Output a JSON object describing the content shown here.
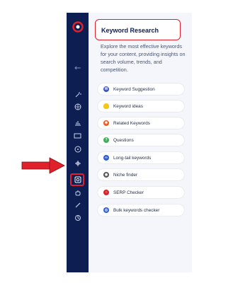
{
  "panel": {
    "title": "Keyword Research",
    "description": "Explore the most effective keywords for your content, providing insights on search volume, trends, and competition."
  },
  "menu": {
    "items": [
      {
        "label": "Keyword Suggestion",
        "icon": "keyword-suggestion-icon",
        "color": "#3b57c4"
      },
      {
        "label": "Keyword ideas",
        "icon": "lightbulb-icon",
        "color": "#f5c518"
      },
      {
        "label": "Related Keywords",
        "icon": "related-keywords-icon",
        "color": "#ef5a24"
      },
      {
        "label": "Questions",
        "icon": "question-icon",
        "color": "#3fae5a"
      },
      {
        "label": "Long-tail keywords",
        "icon": "long-tail-icon",
        "color": "#2f5fd0"
      },
      {
        "label": "Niche finder",
        "icon": "niche-finder-icon",
        "color": "#555555"
      },
      {
        "label": "SERP Checker",
        "icon": "serp-checker-icon",
        "color": "#e0202a"
      },
      {
        "label": "Bulk keywords checker",
        "icon": "bulk-checker-icon",
        "color": "#2f5fd0"
      }
    ]
  },
  "colors": {
    "sidebar": "#0d1f52",
    "highlight": "#e0202a",
    "panel_bg": "#f4f6fb"
  }
}
